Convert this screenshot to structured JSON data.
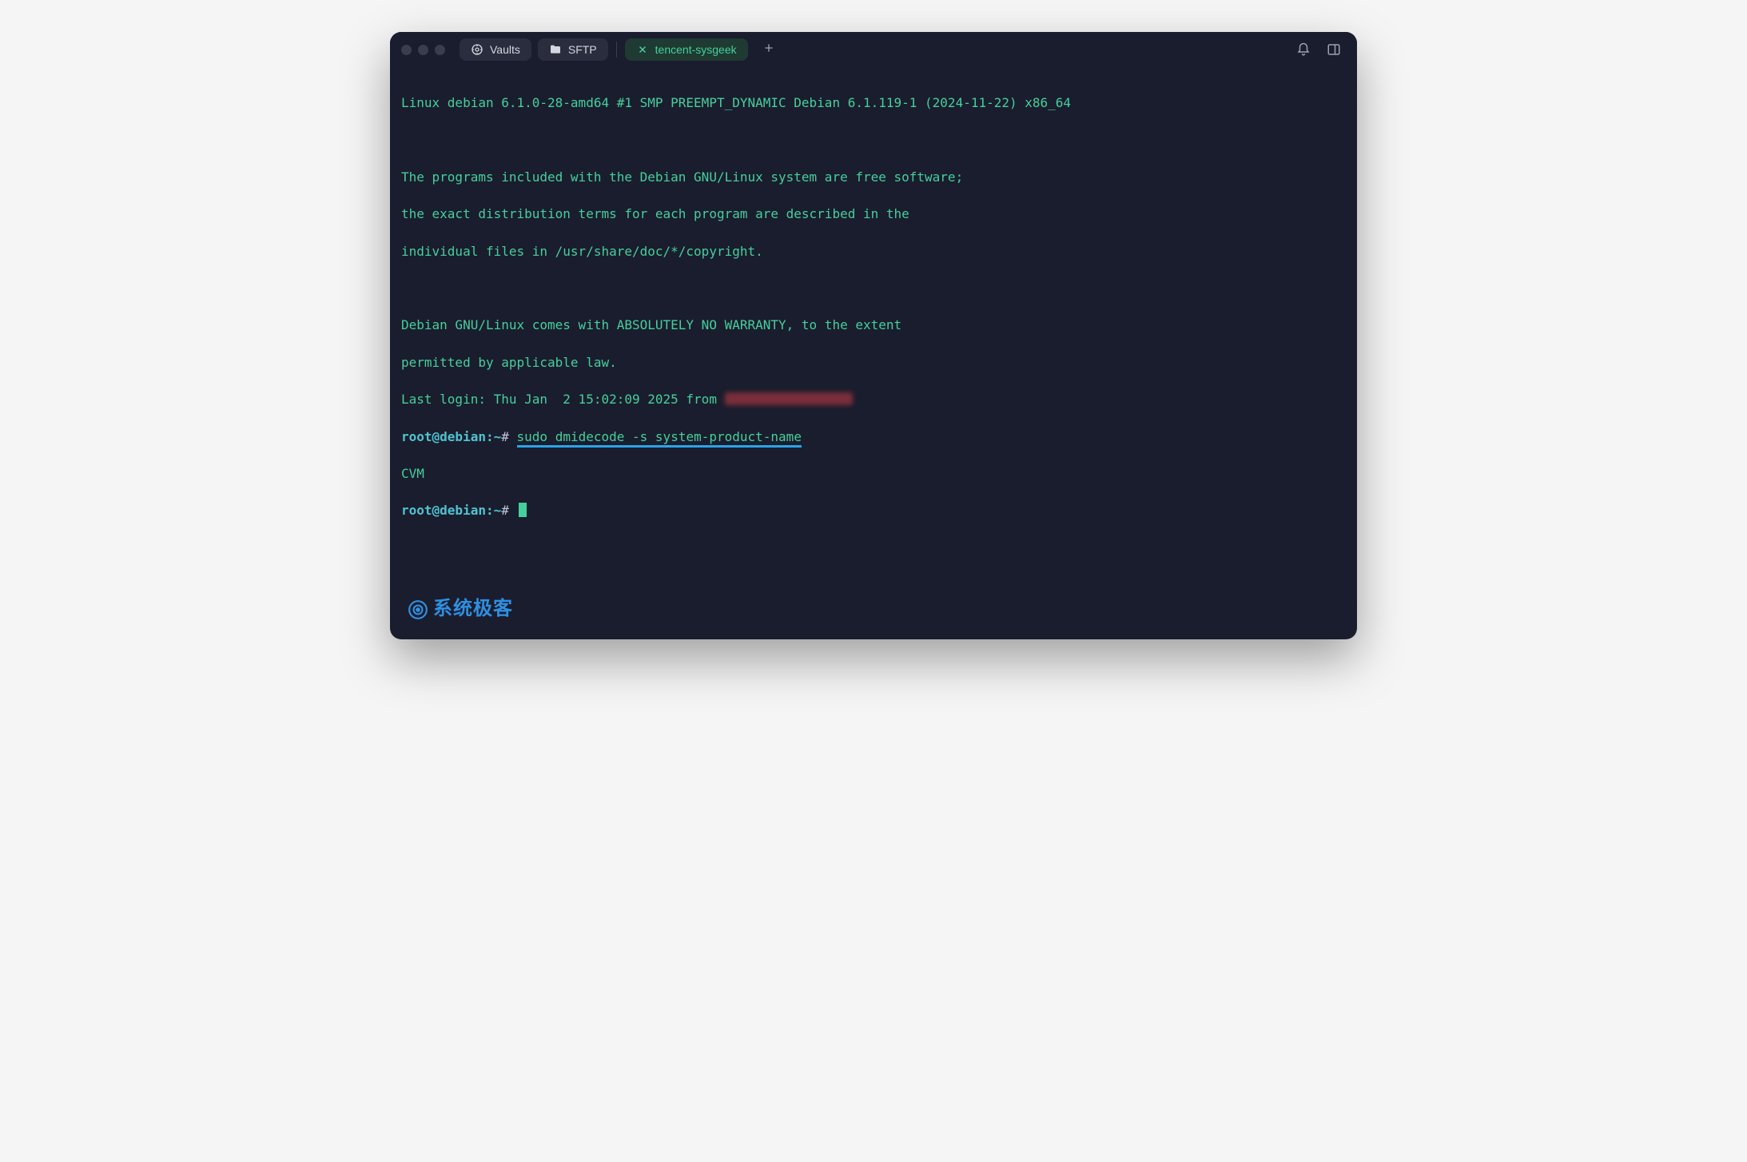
{
  "tabs": {
    "vaults": {
      "label": "Vaults"
    },
    "sftp": {
      "label": "SFTP"
    },
    "active": {
      "label": "tencent-sysgeek"
    }
  },
  "terminal": {
    "banner1": "Linux debian 6.1.0-28-amd64 #1 SMP PREEMPT_DYNAMIC Debian 6.1.119-1 (2024-11-22) x86_64",
    "motd1": "The programs included with the Debian GNU/Linux system are free software;",
    "motd2": "the exact distribution terms for each program are described in the",
    "motd3": "individual files in /usr/share/doc/*/copyright.",
    "motd4": "Debian GNU/Linux comes with ABSOLUTELY NO WARRANTY, to the extent",
    "motd5": "permitted by applicable law.",
    "lastlogin_prefix": "Last login: Thu Jan  2 15:02:09 2025 from",
    "prompt_user": "root@debian",
    "prompt_sep": ":",
    "prompt_path": "~",
    "prompt_hash": "#",
    "command1": "sudo dmidecode -s system-product-name",
    "output1": "CVM"
  },
  "watermark": {
    "text": "系统极客"
  }
}
